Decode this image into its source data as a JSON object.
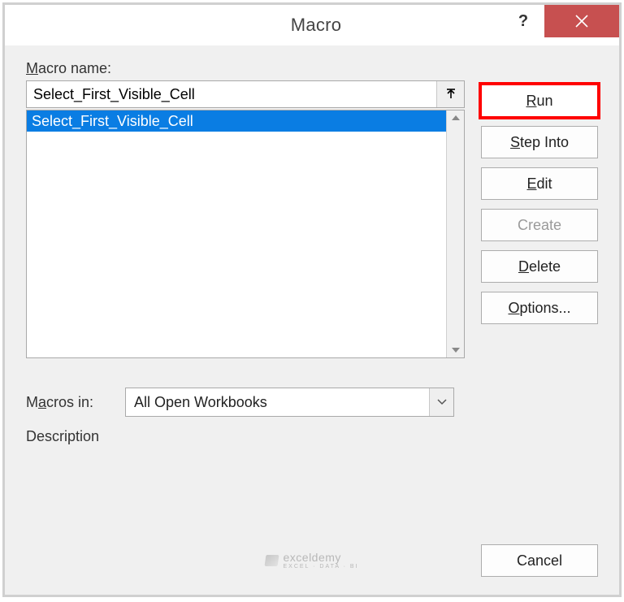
{
  "title": "Macro",
  "labels": {
    "macro_name": "acro name:",
    "macro_name_prefix": "M",
    "macros_in_prefix": "M",
    "macros_in_mid": "cros in:",
    "macros_in_ul": "a",
    "description": "Description"
  },
  "macro_name_value": "Select_First_Visible_Cell",
  "macro_list": [
    "Select_First_Visible_Cell"
  ],
  "macros_in_selected": "All Open Workbooks",
  "buttons": {
    "run": "un",
    "run_ul": "R",
    "step_into_pre": "",
    "step_into_ul": "S",
    "step_into_post": "tep Into",
    "edit_pre": "",
    "edit_ul": "E",
    "edit_post": "dit",
    "create": "Create",
    "delete_pre": "",
    "delete_ul": "D",
    "delete_post": "elete",
    "options_pre": "",
    "options_ul": "O",
    "options_post": "ptions...",
    "cancel": "Cancel"
  },
  "watermark": {
    "main": "exceldemy",
    "sub": "EXCEL · DATA · BI"
  }
}
